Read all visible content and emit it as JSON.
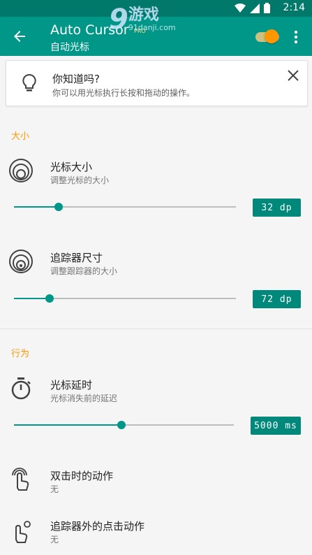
{
  "status_bar": {
    "time": "2:14",
    "icons": [
      "wifi-icon",
      "signal-icon",
      "battery-icon"
    ]
  },
  "watermark": {
    "number": "9",
    "title": "游戏",
    "url": "91danji.com"
  },
  "app_bar": {
    "title": "Auto Cursor",
    "badge": "PRO",
    "subtitle": "自动光标",
    "toggle_on": true
  },
  "tip": {
    "title": "你知道吗?",
    "body": "你可以用光标执行长按和拖动的操作。"
  },
  "sections": {
    "size": {
      "label": "大小",
      "cursor_size": {
        "title": "光标大小",
        "summary": "调整光标的大小",
        "value": "32 dp",
        "fraction": 0.2
      },
      "tracker_size": {
        "title": "追踪器尺寸",
        "summary": "调整跟踪器的大小",
        "value": "72 dp",
        "fraction": 0.16
      }
    },
    "behavior": {
      "label": "行为",
      "cursor_delay": {
        "title": "光标延时",
        "summary": "光标消失前的延迟",
        "value": "5000 ms",
        "fraction": 0.49
      },
      "double_tap": {
        "title": "双击时的动作",
        "summary": "无"
      },
      "outside_tap": {
        "title": "追踪器外的点击动作",
        "summary": "无"
      }
    }
  },
  "colors": {
    "primary": "#009688",
    "primary_dark": "#00796b",
    "accent": "#ff9800"
  }
}
